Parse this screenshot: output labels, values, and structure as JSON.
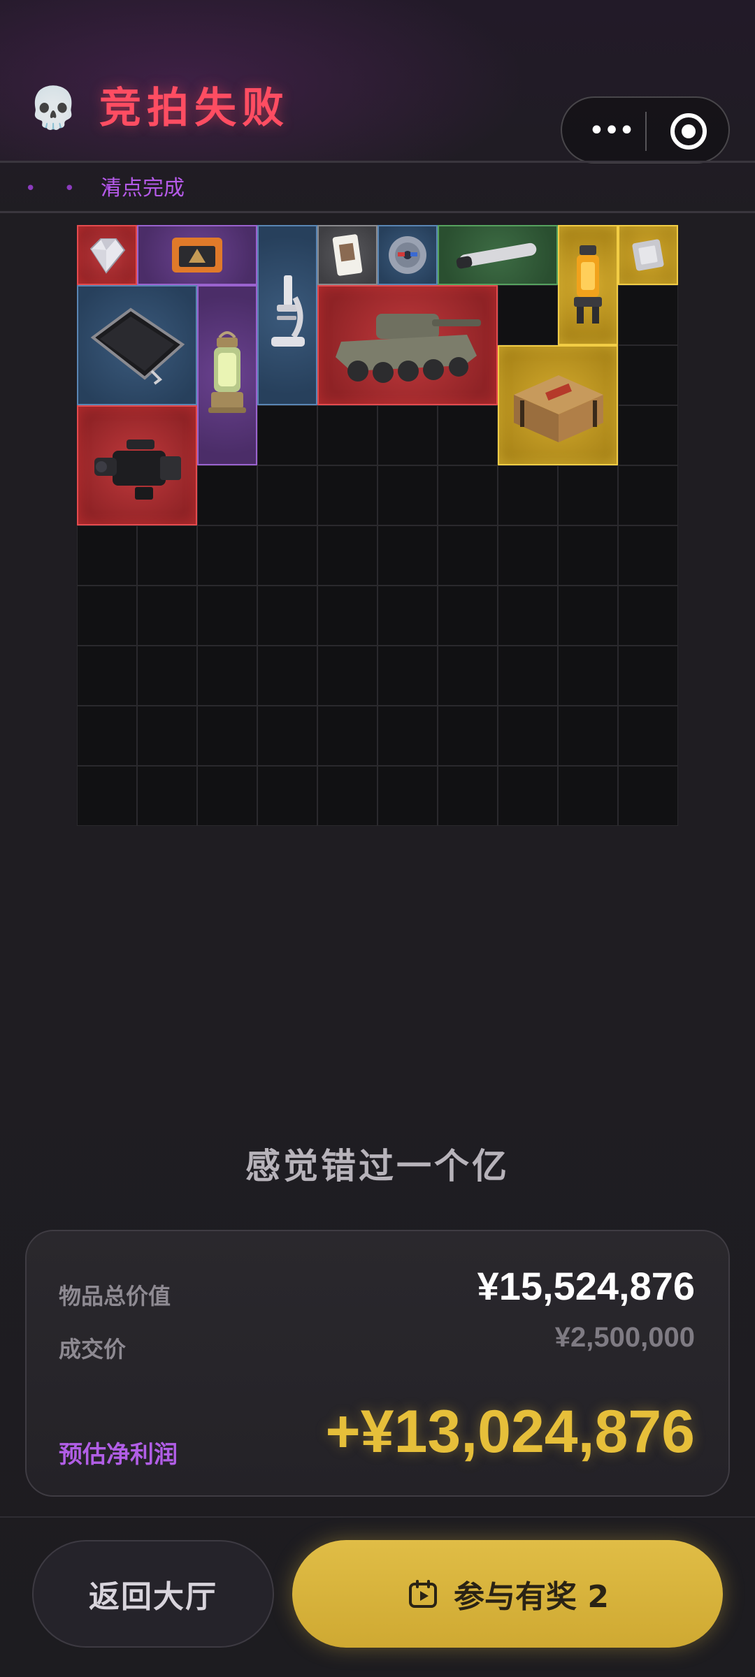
{
  "header": {
    "title": "竞拍失败",
    "icon": "skull-icon"
  },
  "capsule": {
    "more_icon": "more-dots-icon",
    "close_icon": "target-icon"
  },
  "status": {
    "dots": "• • •",
    "text": "清点完成"
  },
  "grid": {
    "columns": 10,
    "rows": 10,
    "items": [
      {
        "name": "diamond",
        "rarity": "red"
      },
      {
        "name": "tablet-device",
        "rarity": "purple"
      },
      {
        "name": "microscope",
        "rarity": "blue"
      },
      {
        "name": "playing-card",
        "rarity": "gray"
      },
      {
        "name": "compact-disc",
        "rarity": "blue"
      },
      {
        "name": "tube",
        "rarity": "green"
      },
      {
        "name": "fluid-canister",
        "rarity": "gold"
      },
      {
        "name": "cpu-chip",
        "rarity": "gold"
      },
      {
        "name": "laptop-screen",
        "rarity": "blue"
      },
      {
        "name": "lantern",
        "rarity": "purple"
      },
      {
        "name": "armored-vehicle",
        "rarity": "red"
      },
      {
        "name": "supply-crate",
        "rarity": "gold"
      },
      {
        "name": "video-camera",
        "rarity": "red"
      }
    ]
  },
  "slogan": "感觉错过一个亿",
  "summary": {
    "total_label": "物品总价值",
    "total_value": "¥15,524,876",
    "price_label": "成交价",
    "price_value": "¥2,500,000",
    "profit_label": "预估净利润",
    "profit_value": "+¥13,024,876"
  },
  "buttons": {
    "back_label": "返回大厅",
    "join_label": "参与有奖 2"
  },
  "colors": {
    "title": "#ff4d62",
    "accent_purple": "#b55ae8",
    "gold": "#e6bf3a",
    "background": "#1f1d22"
  }
}
